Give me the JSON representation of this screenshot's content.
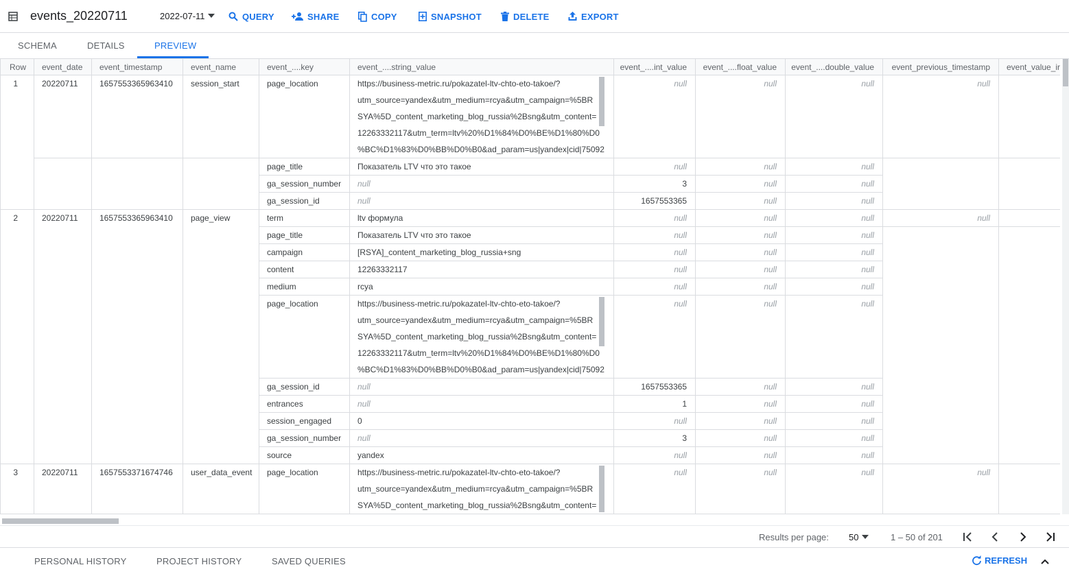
{
  "header": {
    "title": "events_20220711",
    "date": "2022-07-11",
    "actions": {
      "query": "QUERY",
      "share": "SHARE",
      "copy": "COPY",
      "snapshot": "SNAPSHOT",
      "delete": "DELETE",
      "export": "EXPORT"
    },
    "accent": "#1a73e8"
  },
  "tabs": {
    "schema": "SCHEMA",
    "details": "DETAILS",
    "preview": "PREVIEW",
    "active": "PREVIEW"
  },
  "table": {
    "columns": [
      "Row",
      "event_date",
      "event_timestamp",
      "event_name",
      "event_....key",
      "event_....string_value",
      "event_....int_value",
      "event_....float_value",
      "event_....double_value",
      "event_previous_timestamp",
      "event_value_ir"
    ],
    "null_text": "null",
    "rows": [
      {
        "row": "1",
        "event_date": "20220711",
        "event_timestamp": "1657553365963410",
        "event_name": "session_start",
        "params": [
          {
            "key": "page_location",
            "string_value": [
              "https://business-metric.ru/pokazatel-ltv-chto-eto-takoe/?",
              "utm_source=yandex&utm_medium=rcya&utm_campaign=%5BR",
              "SYA%5D_content_marketing_blog_russia%2Bsng&utm_content=",
              "12263332117&utm_term=ltv%20%D1%84%D0%BE%D1%80%D0",
              "%BC%D1%83%D0%BB%D0%B0&ad_param=us|yandex|cid|75092"
            ],
            "int_value": null,
            "float_value": null,
            "double_value": null
          },
          {
            "key": "page_title",
            "string_value": [
              "Показатель LTV что это такое"
            ],
            "int_value": null,
            "float_value": null,
            "double_value": null
          },
          {
            "key": "ga_session_number",
            "string_value": null,
            "int_value": "3",
            "float_value": null,
            "double_value": null
          },
          {
            "key": "ga_session_id",
            "string_value": null,
            "int_value": "1657553365",
            "float_value": null,
            "double_value": null
          }
        ]
      },
      {
        "row": "2",
        "event_date": "20220711",
        "event_timestamp": "1657553365963410",
        "event_name": "page_view",
        "params": [
          {
            "key": "term",
            "string_value": [
              "ltv формула"
            ],
            "int_value": null,
            "float_value": null,
            "double_value": null
          },
          {
            "key": "page_title",
            "string_value": [
              "Показатель LTV что это такое"
            ],
            "int_value": null,
            "float_value": null,
            "double_value": null
          },
          {
            "key": "campaign",
            "string_value": [
              "[RSYA]_content_marketing_blog_russia+sng"
            ],
            "int_value": null,
            "float_value": null,
            "double_value": null
          },
          {
            "key": "content",
            "string_value": [
              "12263332117"
            ],
            "int_value": null,
            "float_value": null,
            "double_value": null
          },
          {
            "key": "medium",
            "string_value": [
              "rcya"
            ],
            "int_value": null,
            "float_value": null,
            "double_value": null
          },
          {
            "key": "page_location",
            "string_value": [
              "https://business-metric.ru/pokazatel-ltv-chto-eto-takoe/?",
              "utm_source=yandex&utm_medium=rcya&utm_campaign=%5BR",
              "SYA%5D_content_marketing_blog_russia%2Bsng&utm_content=",
              "12263332117&utm_term=ltv%20%D1%84%D0%BE%D1%80%D0",
              "%BC%D1%83%D0%BB%D0%B0&ad_param=us|yandex|cid|75092"
            ],
            "int_value": null,
            "float_value": null,
            "double_value": null
          },
          {
            "key": "ga_session_id",
            "string_value": null,
            "int_value": "1657553365",
            "float_value": null,
            "double_value": null
          },
          {
            "key": "entrances",
            "string_value": null,
            "int_value": "1",
            "float_value": null,
            "double_value": null
          },
          {
            "key": "session_engaged",
            "string_value": [
              "0"
            ],
            "int_value": null,
            "float_value": null,
            "double_value": null
          },
          {
            "key": "ga_session_number",
            "string_value": null,
            "int_value": "3",
            "float_value": null,
            "double_value": null
          },
          {
            "key": "source",
            "string_value": [
              "yandex"
            ],
            "int_value": null,
            "float_value": null,
            "double_value": null
          }
        ]
      },
      {
        "row": "3",
        "event_date": "20220711",
        "event_timestamp": "1657553371674746",
        "event_name": "user_data_event",
        "params": [
          {
            "key": "page_location",
            "string_value": [
              "https://business-metric.ru/pokazatel-ltv-chto-eto-takoe/?",
              "utm_source=yandex&utm_medium=rcya&utm_campaign=%5BR",
              "SYA%5D_content_marketing_blog_russia%2Bsng&utm_content="
            ],
            "int_value": null,
            "float_value": null,
            "double_value": null
          }
        ]
      }
    ]
  },
  "pager": {
    "results_label": "Results per page:",
    "per_page": "50",
    "range": "1 – 50 of 201"
  },
  "bottom": {
    "personal_history": "PERSONAL HISTORY",
    "project_history": "PROJECT HISTORY",
    "saved_queries": "SAVED QUERIES",
    "refresh": "REFRESH"
  }
}
